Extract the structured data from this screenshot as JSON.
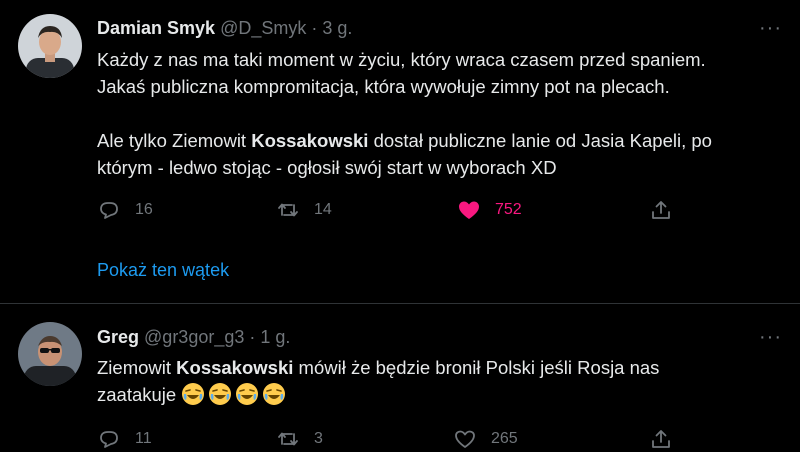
{
  "tweet1": {
    "name": "Damian Smyk",
    "handle": "@D_Smyk",
    "separator": "·",
    "time": "3 g.",
    "more": "···",
    "text_lines": [
      "Każdy z nas ma taki moment w życiu, który wraca czasem przed spaniem.",
      "Jakaś publiczna kompromitacja, która wywołuje zimny pot na plecach."
    ],
    "text2_before": "Ale tylko Ziemowit ",
    "text2_bold": "Kossakowski",
    "text2_after": " dostał publiczne lanie od Jasia Kapeli, po",
    "text2_line2": "którym - ledwo stojąc - ogłosił swój start w wyborach XD",
    "replies": "16",
    "retweets": "14",
    "likes": "752",
    "show_thread": "Pokaż ten wątek"
  },
  "tweet2": {
    "name": "Greg",
    "handle": "@gr3gor_g3",
    "separator": "·",
    "time": "1 g.",
    "more": "···",
    "text_before": "Ziemowit ",
    "text_bold": "Kossakowski",
    "text_after": " mówił że będzie bronił Polski jeśli Rosja nas",
    "text_line2": "zaatakuje",
    "replies": "11",
    "retweets": "3",
    "likes": "265"
  },
  "colors": {
    "background": "#000000",
    "text": "#e7e9ea",
    "muted": "#71767b",
    "like": "#f91880",
    "link": "#1d9bf0",
    "divider": "#2f3336"
  }
}
